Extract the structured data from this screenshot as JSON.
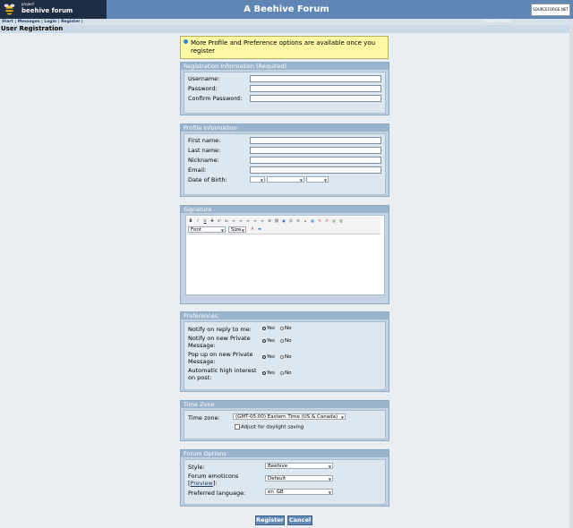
{
  "header": {
    "logo_small": "project",
    "logo_name": "beehive forum",
    "site_title": "A Beehive Forum",
    "sf_badge": "SOURCEFORGE.NET",
    "forum_links": "Forum Links:"
  },
  "nav": {
    "start": "Start",
    "messages": "Messages",
    "login": "Login",
    "register": "Register",
    "sep": "|"
  },
  "page_title": "User Registration",
  "notice": "More Profile and Preference options are available once you register",
  "registration": {
    "title": "Registration Information (Required)",
    "username_label": "Username:",
    "password_label": "Password:",
    "confirm_label": "Confirm Password:"
  },
  "profile": {
    "title": "Profile Information",
    "first_name_label": "First name:",
    "last_name_label": "Last name:",
    "nickname_label": "Nickname:",
    "email_label": "Email:",
    "dob_label": "Date of Birth:"
  },
  "signature": {
    "title": "Signature",
    "toolbar_buttons": [
      "B",
      "I",
      "U",
      "S",
      "x²",
      "x₂",
      "≡",
      "≡",
      "≡",
      "≡",
      "≡",
      "☰",
      "⛓",
      "▣",
      "☺",
      "✉",
      "⌂",
      "▦",
      "✎",
      "✐",
      "▤",
      "▥"
    ],
    "font_label": "Font",
    "size_label": "Size"
  },
  "preferences": {
    "title": "Preferences",
    "items": [
      {
        "label": "Notify on reply to me:",
        "selected": "Yes"
      },
      {
        "label": "Notify on new Private Message:",
        "selected": "Yes"
      },
      {
        "label": "Pop up on new Private Message:",
        "selected": "Yes"
      },
      {
        "label": "Automatic high interest on post:",
        "selected": "Yes"
      }
    ],
    "yes": "Yes",
    "no": "No"
  },
  "timezone": {
    "title": "Time Zone",
    "label": "Time zone:",
    "value": "(GMT-05:00) Eastern Time (US & Canada)",
    "dst_label": "Adjust for daylight saving"
  },
  "forum_options": {
    "title": "Forum Options",
    "style_label": "Style:",
    "style_value": "Beehive",
    "emoticons_label": "Forum emoticons",
    "preview_label": "Preview",
    "emoticons_value": "Default",
    "language_label": "Preferred language:",
    "language_value": "en_GB"
  },
  "buttons": {
    "register": "Register",
    "cancel": "Cancel"
  }
}
